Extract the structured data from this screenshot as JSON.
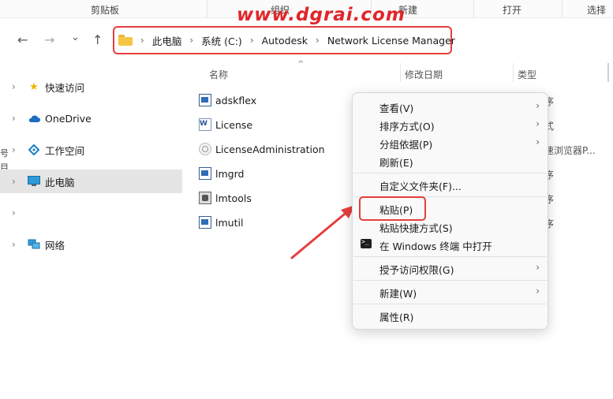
{
  "ribbon": {
    "groups": [
      "剪贴板",
      "组织",
      "新建",
      "打开",
      "选择"
    ]
  },
  "watermark": "www.dgrai.com",
  "nav": {
    "back": "←",
    "forward": "→",
    "recent": "⌄",
    "up": "↑"
  },
  "breadcrumb": [
    "此电脑",
    "系统 (C:)",
    "Autodesk",
    "Network License Manager"
  ],
  "sidebar": {
    "items": [
      {
        "label": "快速访问",
        "icon": "star-icon"
      },
      {
        "label": "OneDrive",
        "icon": "cloud-icon"
      },
      {
        "label": "工作空间",
        "icon": "workspace-icon"
      },
      {
        "label": "此电脑",
        "icon": "computer-icon"
      },
      {
        "label": "",
        "icon": ""
      },
      {
        "label": "网络",
        "icon": "network-icon"
      }
    ],
    "edge_letters": [
      "号",
      "目"
    ]
  },
  "columns": {
    "name": "名称",
    "modified": "修改日期",
    "type": "类型"
  },
  "files": [
    {
      "name": "adskflex",
      "type": "序"
    },
    {
      "name": "License",
      "type": "式"
    },
    {
      "name": "LicenseAdministration",
      "type": "速浏览器P..."
    },
    {
      "name": "lmgrd",
      "type": "序"
    },
    {
      "name": "lmtools",
      "type": "序"
    },
    {
      "name": "lmutil",
      "type": "序"
    }
  ],
  "context_menu": {
    "view": "查看(V)",
    "sort": "排序方式(O)",
    "group": "分组依据(P)",
    "refresh": "刷新(E)",
    "customize": "自定义文件夹(F)...",
    "paste": "粘贴(P)",
    "paste_shortcut": "粘贴快捷方式(S)",
    "open_terminal": "在 Windows 终端 中打开",
    "grant_access": "授予访问权限(G)",
    "new": "新建(W)",
    "properties": "属性(R)",
    "submenu_arrow": "›"
  },
  "colors": {
    "highlight": "#e53e3e",
    "selected_bg": "#e5e5e5",
    "menu_bg": "#f9f9f9"
  }
}
